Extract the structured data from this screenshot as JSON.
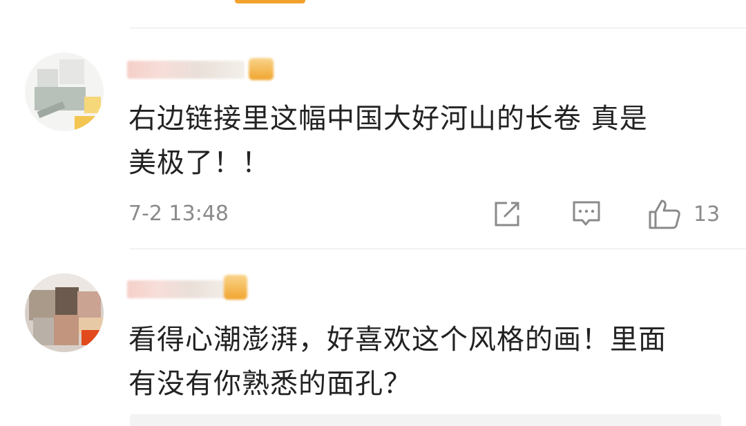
{
  "comments": [
    {
      "text": "右边链接里这幅中国大好河山的长卷 真是\n美极了！！",
      "timestamp": "7-2 13:48",
      "likes": "13",
      "actions": [
        "share-icon",
        "reply-icon",
        "like-icon"
      ]
    },
    {
      "text": "看得心潮澎湃，好喜欢这个风格的画！里面\n有没有你熟悉的面孔？"
    }
  ],
  "colors": {
    "accent": "#f2a12c",
    "text": "#222222",
    "meta": "#8a8a8a",
    "divider": "#e6e6e6"
  }
}
